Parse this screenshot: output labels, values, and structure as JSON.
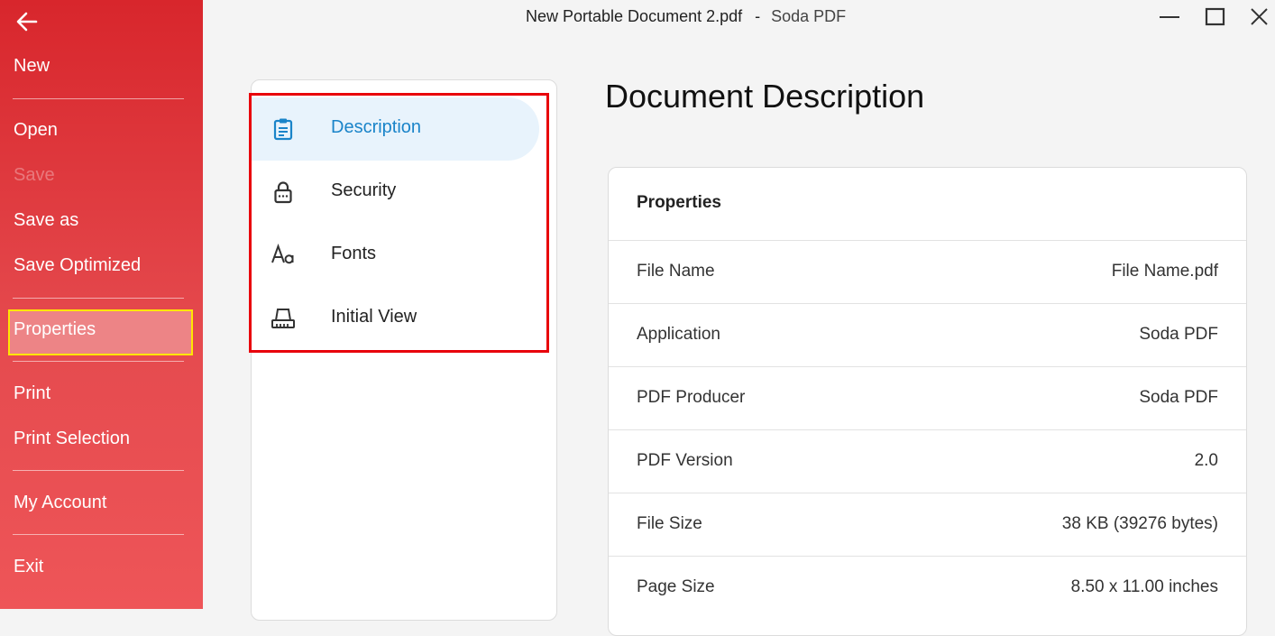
{
  "window": {
    "document_name": "New Portable Document 2.pdf",
    "separator": "-",
    "app_name": "Soda PDF"
  },
  "sidebar": {
    "back_icon": "arrow-left-icon",
    "items": [
      {
        "label": "New"
      },
      {
        "label": "Open"
      },
      {
        "label": "Save"
      },
      {
        "label": "Save as"
      },
      {
        "label": "Save Optimized"
      },
      {
        "label": "Properties"
      },
      {
        "label": "Print"
      },
      {
        "label": "Print Selection"
      },
      {
        "label": "My Account"
      },
      {
        "label": "Exit"
      }
    ],
    "selected": "Properties",
    "disabled": [
      "Save"
    ],
    "background": "#e2383d",
    "highlight_border": "#ffe600"
  },
  "nav": {
    "items": [
      {
        "label": "Description",
        "icon": "clipboard-icon"
      },
      {
        "label": "Security",
        "icon": "lock-icon"
      },
      {
        "label": "Fonts",
        "icon": "font-icon"
      },
      {
        "label": "Initial View",
        "icon": "ruler-icon"
      }
    ],
    "active": "Description",
    "accent": "#1a84c9",
    "annotation_border": "#e8000b"
  },
  "main": {
    "title": "Document Description",
    "card": {
      "header": "Properties",
      "rows": [
        {
          "key": "File Name",
          "value": "File Name.pdf"
        },
        {
          "key": "Application",
          "value": "Soda PDF"
        },
        {
          "key": "PDF Producer",
          "value": "Soda PDF"
        },
        {
          "key": "PDF Version",
          "value": "2.0"
        },
        {
          "key": "File Size",
          "value": "38 KB (39276 bytes)"
        },
        {
          "key": "Page Size",
          "value": "8.50 x 11.00 inches"
        }
      ]
    }
  }
}
